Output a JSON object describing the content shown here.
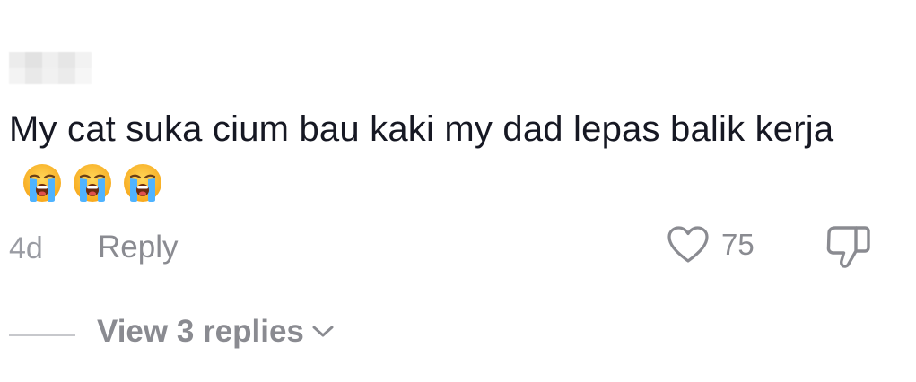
{
  "comment": {
    "text": "My cat suka cium bau kaki my dad lepas balik kerja",
    "emojis": [
      "loudly-crying-face-icon",
      "loudly-crying-face-icon",
      "loudly-crying-face-icon"
    ]
  },
  "meta": {
    "time": "4d",
    "reply_label": "Reply",
    "like_count": "75"
  },
  "replies": {
    "label": "View 3 replies"
  },
  "colors": {
    "text": "#161823",
    "secondary": "#8a8b91",
    "icon": "#8a8b91"
  }
}
